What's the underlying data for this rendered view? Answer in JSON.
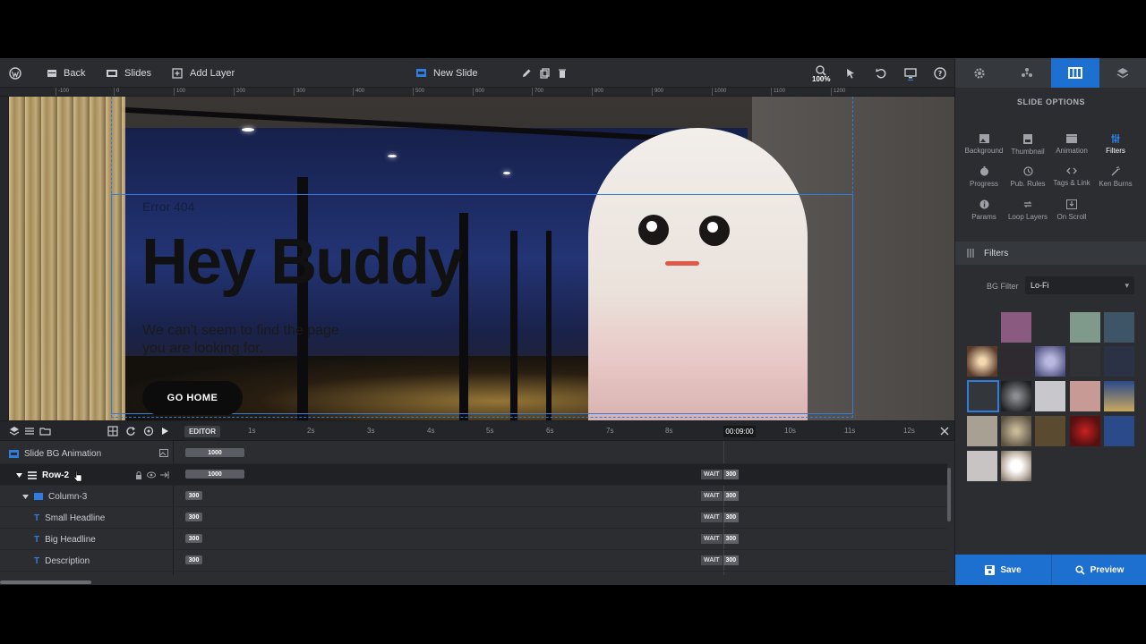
{
  "toolbar": {
    "back_label": "Back",
    "slides_label": "Slides",
    "add_layer_label": "Add Layer",
    "slide_name": "New Slide",
    "zoom": "100%"
  },
  "ruler": {
    "ticks": [
      "-100",
      "0",
      "100",
      "200",
      "300",
      "400",
      "500",
      "600",
      "700",
      "800",
      "900",
      "1000",
      "1100",
      "1200"
    ]
  },
  "canvas": {
    "small_headline": "Error 404",
    "big_headline": "Hey Buddy",
    "description": "We can't seem to find the page you are looking for.",
    "button_label": "GO HOME"
  },
  "timeline": {
    "editor_label": "EDITOR",
    "timecode": "00:09:00",
    "seconds": [
      "1s",
      "2s",
      "3s",
      "4s",
      "5s",
      "6s",
      "7s",
      "8s",
      "9s",
      "10s",
      "11s",
      "12s"
    ],
    "rows": [
      {
        "label": "Slide BG Animation",
        "duration": "1000",
        "wait": "",
        "wait_value": ""
      },
      {
        "label": "Row-2",
        "duration": "1000",
        "wait": "WAIT",
        "wait_value": "300"
      },
      {
        "label": "Column-3",
        "duration": "300",
        "wait": "WAIT",
        "wait_value": "300"
      },
      {
        "label": "Small Headline",
        "duration": "300",
        "wait": "WAIT",
        "wait_value": "300"
      },
      {
        "label": "Big Headline",
        "duration": "300",
        "wait": "WAIT",
        "wait_value": "300"
      },
      {
        "label": "Description",
        "duration": "300",
        "wait": "WAIT",
        "wait_value": "300"
      }
    ]
  },
  "panel": {
    "title": "SLIDE OPTIONS",
    "options": [
      "Background",
      "Thumbnail",
      "Animation",
      "Filters",
      "Progress",
      "Pub. Rules",
      "Tags & Link",
      "Ken Burns",
      "Params",
      "Loop Layers",
      "On Scroll"
    ],
    "active_option": "Filters",
    "filters_heading": "Filters",
    "bg_filter_label": "BG Filter",
    "bg_filter_value": "Lo-Fi",
    "save_label": "Save",
    "preview_label": "Preview"
  },
  "colors": {
    "accent": "#1d6fd0",
    "panel_bg": "#2b2d31",
    "selection": "#2f7de0"
  }
}
